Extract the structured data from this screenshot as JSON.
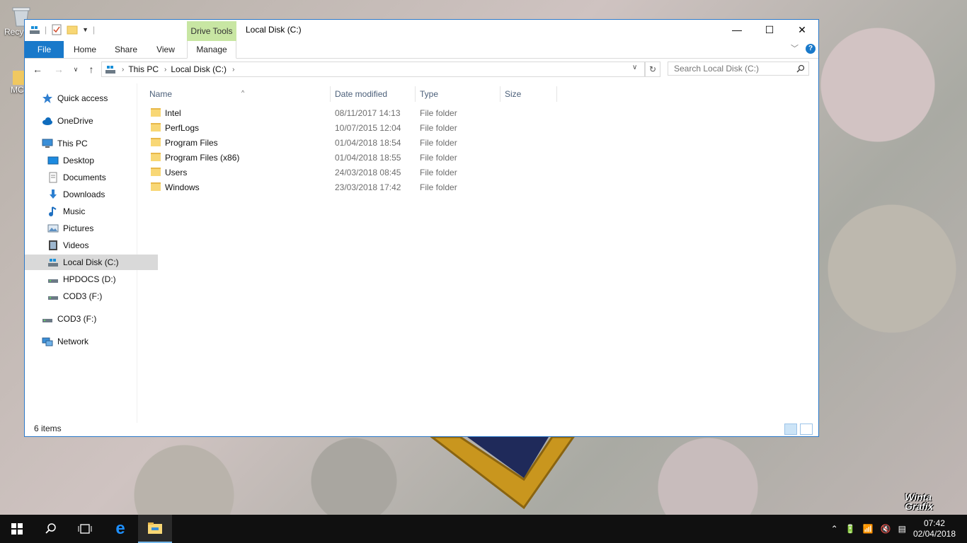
{
  "desktop": {
    "icons": [
      {
        "label": "Recy",
        "name": "recycle-bin"
      },
      {
        "label": "MC",
        "name": "mc-folder"
      }
    ],
    "watermark": "Winta Grafix"
  },
  "window": {
    "title": "Local Disk (C:)",
    "context_tab": "Drive Tools",
    "ribbon_tabs": [
      "File",
      "Home",
      "Share",
      "View",
      "Manage"
    ],
    "help_label": "?",
    "controls": {
      "minimize": "—",
      "maximize": "☐",
      "close": "✕"
    }
  },
  "address": {
    "crumbs": [
      "This PC",
      "Local Disk (C:)"
    ],
    "search_placeholder": "Search Local Disk (C:)"
  },
  "nav_pane": {
    "items": [
      {
        "label": "Quick access",
        "icon": "star-icon",
        "indent": 0
      },
      {
        "label": "OneDrive",
        "icon": "cloud-icon",
        "indent": 0
      },
      {
        "label": "This PC",
        "icon": "computer-icon",
        "indent": 0
      },
      {
        "label": "Desktop",
        "icon": "desktop-icon",
        "indent": 1
      },
      {
        "label": "Documents",
        "icon": "documents-icon",
        "indent": 1
      },
      {
        "label": "Downloads",
        "icon": "download-icon",
        "indent": 1
      },
      {
        "label": "Music",
        "icon": "music-icon",
        "indent": 1
      },
      {
        "label": "Pictures",
        "icon": "pictures-icon",
        "indent": 1
      },
      {
        "label": "Videos",
        "icon": "videos-icon",
        "indent": 1
      },
      {
        "label": "Local Disk (C:)",
        "icon": "drive-icon",
        "indent": 1,
        "selected": true
      },
      {
        "label": "HPDOCS (D:)",
        "icon": "drive-icon",
        "indent": 1
      },
      {
        "label": "COD3 (F:)",
        "icon": "drive-icon",
        "indent": 1
      },
      {
        "label": "COD3 (F:)",
        "icon": "drive-icon",
        "indent": 0
      },
      {
        "label": "Network",
        "icon": "network-icon",
        "indent": 0
      }
    ]
  },
  "file_list": {
    "columns": [
      "Name",
      "Date modified",
      "Type",
      "Size"
    ],
    "rows": [
      {
        "name": "Intel",
        "date": "08/11/2017 14:13",
        "type": "File folder",
        "size": ""
      },
      {
        "name": "PerfLogs",
        "date": "10/07/2015 12:04",
        "type": "File folder",
        "size": ""
      },
      {
        "name": "Program Files",
        "date": "01/04/2018 18:54",
        "type": "File folder",
        "size": ""
      },
      {
        "name": "Program Files (x86)",
        "date": "01/04/2018 18:55",
        "type": "File folder",
        "size": ""
      },
      {
        "name": "Users",
        "date": "24/03/2018 08:45",
        "type": "File folder",
        "size": ""
      },
      {
        "name": "Windows",
        "date": "23/03/2018 17:42",
        "type": "File folder",
        "size": ""
      }
    ]
  },
  "status": {
    "item_count": "6 items"
  },
  "taskbar": {
    "time": "07:42",
    "date": "02/04/2018"
  },
  "colors": {
    "accent": "#1979ca",
    "context_tab": "#c8e6a3",
    "folder": "#f8d775"
  }
}
